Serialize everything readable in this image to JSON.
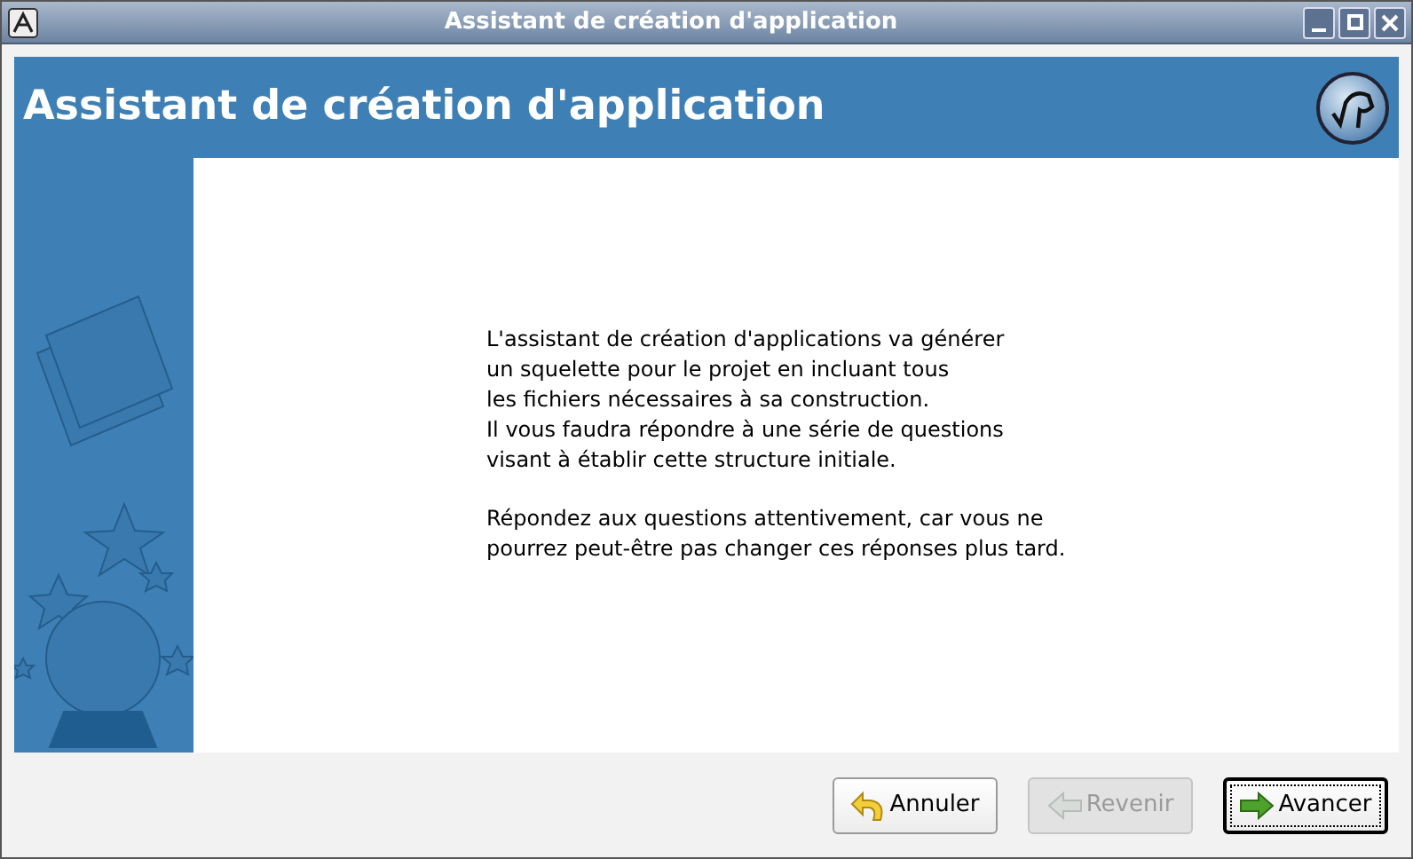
{
  "window": {
    "title": "Assistant de création d'application"
  },
  "banner": {
    "title": "Assistant de création d'application"
  },
  "paragraphs": [
    "L'assistant de création d'applications va générer\nun squelette pour le projet en incluant tous\nles fichiers nécessaires à sa construction.\nIl vous faudra répondre à une série de questions\nvisant à établir cette structure initiale.",
    "Répondez aux questions attentivement, car vous ne\npourrez peut-être pas changer ces réponses plus tard."
  ],
  "buttons": [
    {
      "label": "Annuler",
      "kind": "cancel",
      "disabled": false,
      "focused": false
    },
    {
      "label": "Revenir",
      "kind": "back",
      "disabled": true,
      "focused": false
    },
    {
      "label": "Avancer",
      "kind": "forward",
      "disabled": false,
      "focused": true
    }
  ]
}
